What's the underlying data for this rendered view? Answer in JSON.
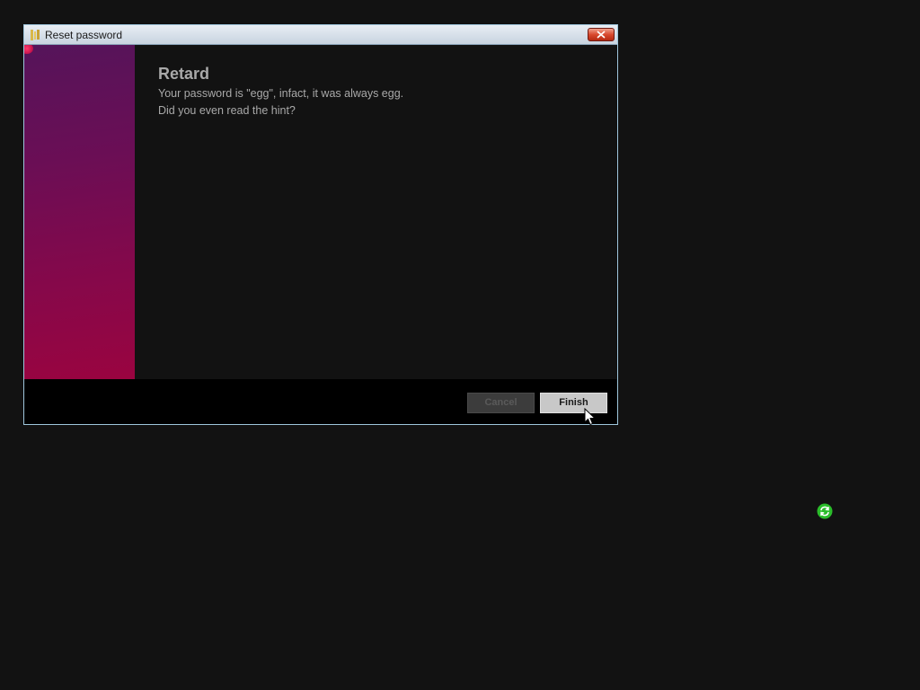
{
  "dialog": {
    "title": "Reset password",
    "icons": {
      "app": "app-icon",
      "close": "close-icon"
    },
    "heading": "Retard",
    "message_lines": [
      "Your password is \"egg\", infact, it was always egg.",
      "Did you even read the hint?"
    ],
    "buttons": {
      "cancel_label": "Cancel",
      "cancel_enabled": false,
      "finish_label": "Finish"
    }
  },
  "desktop": {
    "tray_icon": "refresh-icon"
  },
  "colors": {
    "background": "#121212",
    "panel_gradient_top": "#55145a",
    "panel_gradient_bottom": "#9a0440",
    "text": "#a9a9a9",
    "close_button": "#d94a2f",
    "tray_icon": "#2bbd2b"
  }
}
